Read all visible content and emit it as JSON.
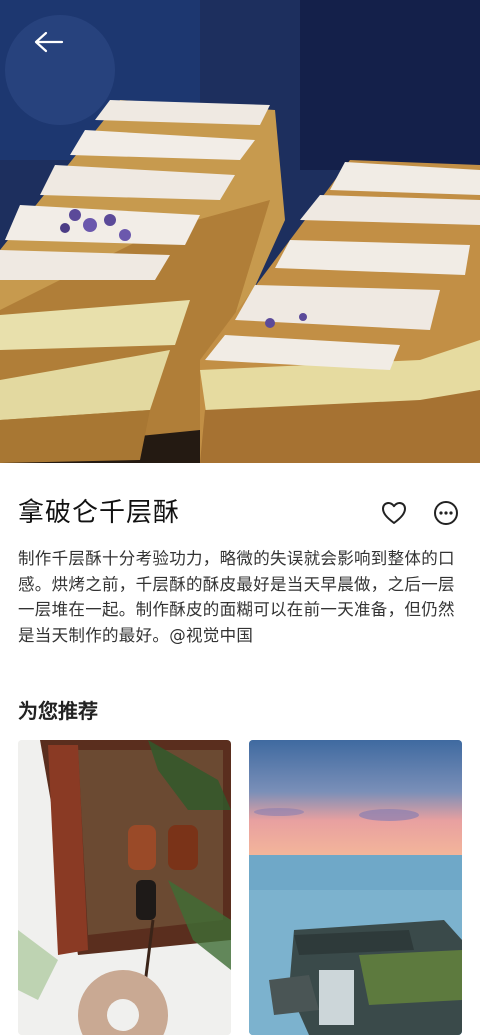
{
  "article": {
    "title": "拿破仑千层酥",
    "description": "制作千层酥十分考验功力，略微的失误就会影响到整体的口感。烘烤之前，千层酥的酥皮最好是当天早晨做，之后一层一层堆在一起。制作酥皮的面糊可以在前一天准备，但仍然是当天制作的最好。@视觉中国"
  },
  "recommend": {
    "title": "为您推荐"
  },
  "icons": {
    "back": "arrow-left-icon",
    "like": "heart-outline-icon",
    "more": "more-circle-icon"
  },
  "colors": {
    "text_primary": "#111111",
    "text_body": "#333333",
    "background": "#ffffff"
  }
}
